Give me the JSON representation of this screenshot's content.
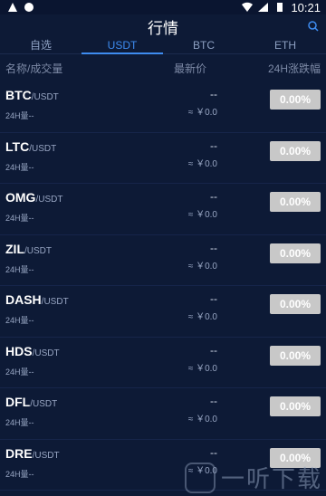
{
  "status": {
    "time": "10:21"
  },
  "header": {
    "title": "行情"
  },
  "tabs": [
    {
      "label": "自选",
      "active": false
    },
    {
      "label": "USDT",
      "active": true
    },
    {
      "label": "BTC",
      "active": false
    },
    {
      "label": "ETH",
      "active": false
    }
  ],
  "columns": {
    "name": "名称/成交量",
    "price": "最新价",
    "change": "24H涨跌幅"
  },
  "rows": [
    {
      "symbol": "BTC",
      "pair": "/USDT",
      "volume": "24H量--",
      "price": "--",
      "approx": "≈ ￥0.0",
      "change": "0.00%"
    },
    {
      "symbol": "LTC",
      "pair": "/USDT",
      "volume": "24H量--",
      "price": "--",
      "approx": "≈ ￥0.0",
      "change": "0.00%"
    },
    {
      "symbol": "OMG",
      "pair": "/USDT",
      "volume": "24H量--",
      "price": "--",
      "approx": "≈ ￥0.0",
      "change": "0.00%"
    },
    {
      "symbol": "ZIL",
      "pair": "/USDT",
      "volume": "24H量--",
      "price": "--",
      "approx": "≈ ￥0.0",
      "change": "0.00%"
    },
    {
      "symbol": "DASH",
      "pair": "/USDT",
      "volume": "24H量--",
      "price": "--",
      "approx": "≈ ￥0.0",
      "change": "0.00%"
    },
    {
      "symbol": "HDS",
      "pair": "/USDT",
      "volume": "24H量--",
      "price": "--",
      "approx": "≈ ￥0.0",
      "change": "0.00%"
    },
    {
      "symbol": "DFL",
      "pair": "/USDT",
      "volume": "24H量--",
      "price": "--",
      "approx": "≈ ￥0.0",
      "change": "0.00%"
    },
    {
      "symbol": "DRE",
      "pair": "/USDT",
      "volume": "24H量--",
      "price": "--",
      "approx": "≈ ￥0.0",
      "change": "0.00%"
    }
  ],
  "watermark": {
    "text": "一听下载"
  },
  "colors": {
    "background": "#0d1a36",
    "accent": "#3e8cf0",
    "change_button": "#c8c8c8"
  }
}
